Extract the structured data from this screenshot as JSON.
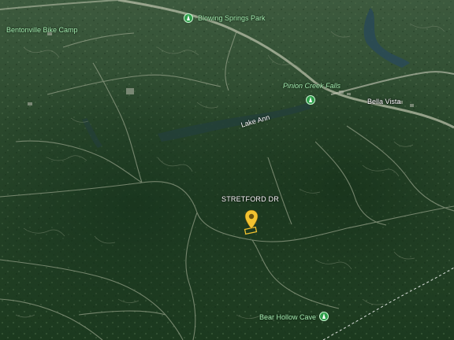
{
  "map": {
    "view": "satellite-3d",
    "colors": {
      "forest": "#2a4a2c",
      "label_green": "#a8f0b4",
      "pin": "#f2c230",
      "poi_icon": "#2e9e4a"
    },
    "labels": {
      "bentonville_bike_camp": "Bentonville Bike Camp",
      "blowing_springs_park": "Blowing Springs Park",
      "pinion_creek_falls": "Pinion Creek Falls",
      "bella_vista": "Bella Vista",
      "lake_ann": "Lake Ann",
      "stretford_dr": "STRETFORD DR",
      "bear_hollow_cave": "Bear Hollow Cave"
    },
    "icons": {
      "park": "tree-icon",
      "falls": "tree-icon",
      "cave": "tree-icon",
      "pin": "location-pin-icon"
    }
  }
}
